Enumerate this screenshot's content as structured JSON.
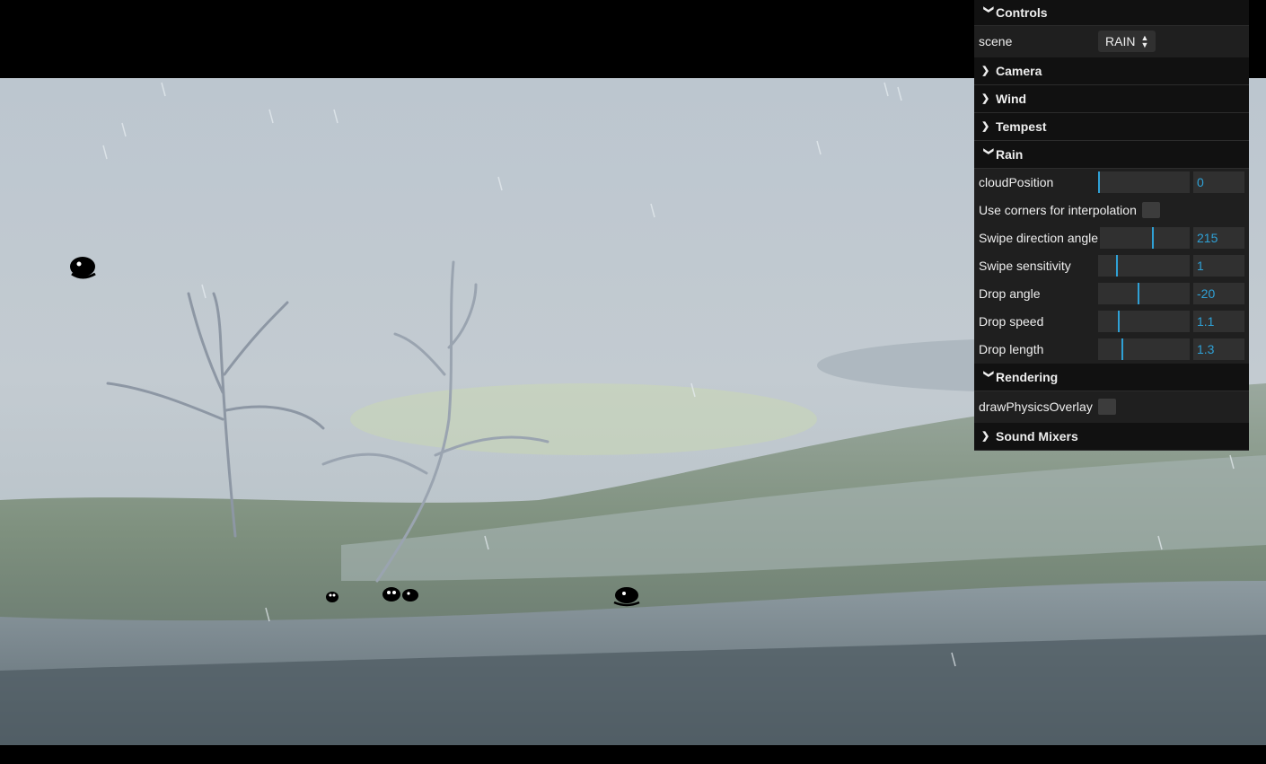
{
  "gui": {
    "controls_title": "Controls",
    "scene_label": "scene",
    "scene_value": "RAIN",
    "folders": {
      "camera": "Camera",
      "wind": "Wind",
      "tempest": "Tempest",
      "rain": "Rain",
      "rendering": "Rendering",
      "sound_mixers": "Sound Mixers"
    },
    "rain": {
      "cloud_position": {
        "label": "cloudPosition",
        "value": "0",
        "fraction": 0.0
      },
      "use_corners": {
        "label": "Use corners for interpolation"
      },
      "swipe_angle": {
        "label": "Swipe direction angle",
        "value": "215",
        "fraction": 0.59
      },
      "swipe_sensitivity": {
        "label": "Swipe sensitivity",
        "value": "1",
        "fraction": 0.2
      },
      "drop_angle": {
        "label": "Drop angle",
        "value": "-20",
        "fraction": 0.44
      },
      "drop_speed": {
        "label": "Drop speed",
        "value": "1.1",
        "fraction": 0.22
      },
      "drop_length": {
        "label": "Drop length",
        "value": "1.3",
        "fraction": 0.26
      }
    },
    "rendering": {
      "draw_physics_overlay": {
        "label": "drawPhysicsOverlay"
      }
    },
    "accent": "#2fa1d6"
  }
}
